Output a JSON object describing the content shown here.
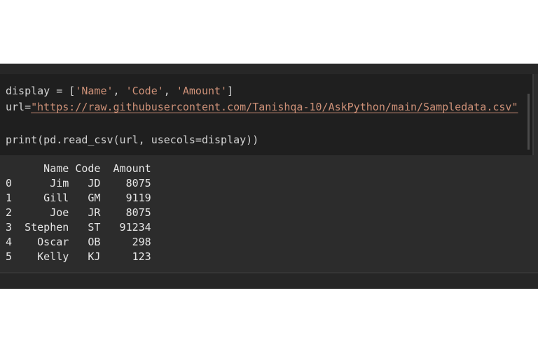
{
  "code_cell": {
    "line1": {
      "prefix": "display = [",
      "s1": "'Name'",
      "sep1": ", ",
      "s2": "'Code'",
      "sep2": ", ",
      "s3": "'Amount'",
      "suffix": "]"
    },
    "line2": {
      "prefix": "url=",
      "url": "\"https://raw.githubusercontent.com/Tanishqa-10/AskPython/main/Sampledata.csv\""
    },
    "line4": "print(pd.read_csv(url, usecols=display))"
  },
  "output": {
    "header": "      Name Code  Amount",
    "rows": [
      "0      Jim   JD    8075",
      "1     Gill   GM    9119",
      "2      Joe   JR    8075",
      "3  Stephen   ST   91234",
      "4    Oscar   OB     298",
      "5    Kelly   KJ     123"
    ]
  },
  "colors": {
    "code_bg": "#1f1f1f",
    "output_bg": "#2c2c2c",
    "string": "#ce9178",
    "text": "#d4d4d4"
  }
}
